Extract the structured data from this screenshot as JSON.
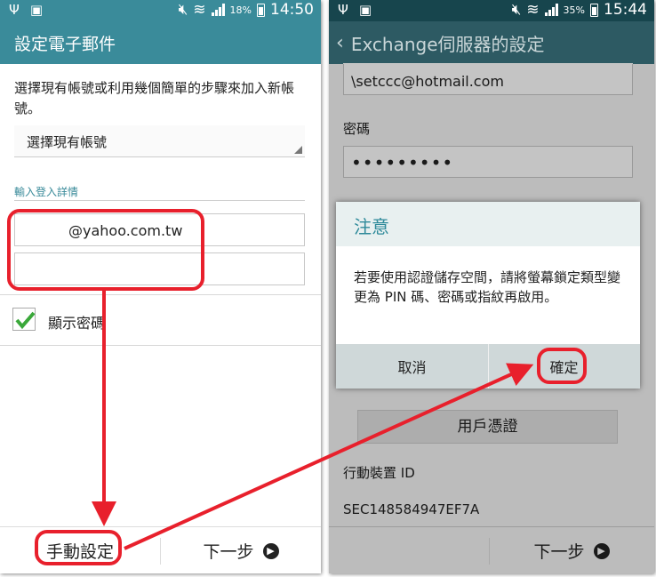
{
  "left_phone": {
    "status": {
      "battery": "18%",
      "time": "14:50"
    },
    "title": "設定電子郵件",
    "intro": "選擇現有帳號或利用幾個簡單的步驟來加入新帳號。",
    "account_select": "選擇現有帳號",
    "section_label": "輸入登入詳情",
    "email_value": "@yahoo.com.tw",
    "password_value": "",
    "show_password_label": "顯示密碼",
    "show_password_checked": true,
    "manual_setup_button": "手動設定",
    "next_button": "下一步"
  },
  "right_phone": {
    "status": {
      "battery": "35%",
      "time": "15:44"
    },
    "title": "Exchange伺服器的設定",
    "email_value": "\\setccc@hotmail.com",
    "password_label": "密碼",
    "password_value": "•••••••••",
    "user_cert_button": "用戶憑證",
    "device_id_label": "行動裝置 ID",
    "device_id_value": "SEC148584947EF7A",
    "next_button": "下一步",
    "dialog": {
      "title": "注意",
      "message": "若要使用認證儲存空間，請將螢幕鎖定類型變更為 PIN 碼、密碼或指紋再啟用。",
      "cancel_button": "取消",
      "ok_button": "確定"
    }
  },
  "colors": {
    "left_header": "#3a8b9a",
    "right_header": "#2d5a63",
    "annotation": "#e8202c",
    "check": "#3aa83a"
  },
  "icons": [
    "usb-icon",
    "sd-card-icon",
    "mute-icon",
    "wifi-icon",
    "signal-icon",
    "battery-icon",
    "back-arrow-icon",
    "next-arrow-icon",
    "checkmark-icon",
    "dropdown-triangle-icon"
  ]
}
